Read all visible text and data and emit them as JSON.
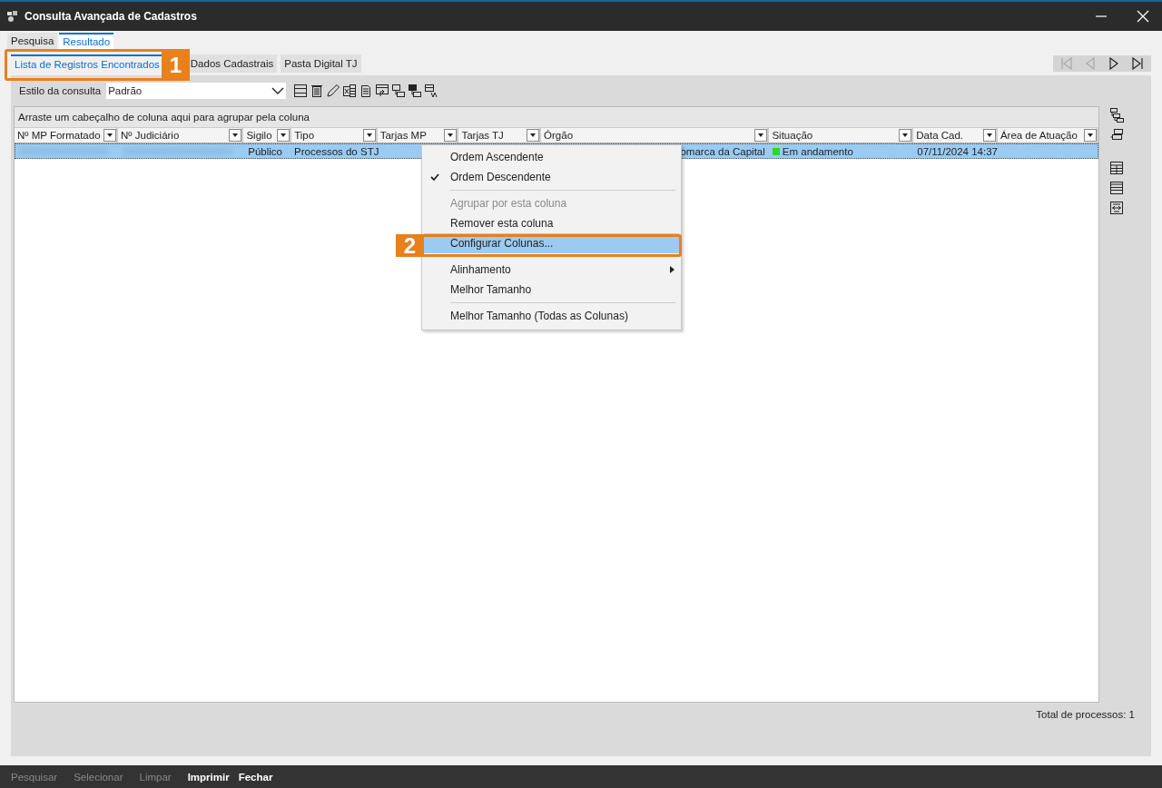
{
  "window": {
    "title": "Consulta Avançada de Cadastros"
  },
  "tabs": [
    {
      "label": "Pesquisa",
      "selected": false
    },
    {
      "label": "Resultado",
      "selected": true
    }
  ],
  "subtabs": [
    {
      "label": "Lista de Registros Encontrados",
      "selected": true
    },
    {
      "label": "Dados Cadastrais",
      "selected": false
    },
    {
      "label": "Pasta Digital TJ",
      "selected": false
    }
  ],
  "nav_buttons": [
    {
      "kind": "first",
      "disabled": true
    },
    {
      "kind": "prev",
      "disabled": true
    },
    {
      "kind": "next",
      "disabled": false
    },
    {
      "kind": "last",
      "disabled": false
    }
  ],
  "style_field": {
    "label": "Estilo da consulta",
    "value": "Padrão"
  },
  "group_hint": "Arraste um cabeçalho de coluna aqui para agrupar pela coluna",
  "columns": [
    {
      "label": "Nº MP Formatado"
    },
    {
      "label": "Nº Judiciário"
    },
    {
      "label": "Sigilo"
    },
    {
      "label": "Tipo"
    },
    {
      "label": "Tarjas MP"
    },
    {
      "label": "Tarjas TJ"
    },
    {
      "label": "Órgão"
    },
    {
      "label": "Situação"
    },
    {
      "label": "Data Cad."
    },
    {
      "label": "Área de Atuação"
    }
  ],
  "rows": [
    {
      "selected": true,
      "cells": [
        {
          "kind": "blurred"
        },
        {
          "kind": "blurred"
        },
        {
          "kind": "text",
          "text": "Público"
        },
        {
          "kind": "text",
          "text": "Processos do STJ"
        },
        {
          "kind": "empty"
        },
        {
          "kind": "empty"
        },
        {
          "kind": "clipped",
          "text": "omarca da Capital"
        },
        {
          "kind": "status",
          "color": "#22dd22",
          "text": "Em andamento"
        },
        {
          "kind": "text",
          "text": "07/11/2024 14:37"
        },
        {
          "kind": "empty"
        }
      ]
    }
  ],
  "context_menu": [
    {
      "kind": "item",
      "label": "Ordem Ascendente",
      "checked": false,
      "disabled": false,
      "selected": false,
      "submenu": false
    },
    {
      "kind": "item",
      "label": "Ordem Descendente",
      "checked": true,
      "disabled": false,
      "selected": false,
      "submenu": false
    },
    {
      "kind": "separator"
    },
    {
      "kind": "item",
      "label": "Agrupar por esta coluna",
      "checked": false,
      "disabled": true,
      "selected": false,
      "submenu": false
    },
    {
      "kind": "item",
      "label": "Remover esta coluna",
      "checked": false,
      "disabled": false,
      "selected": false,
      "submenu": false
    },
    {
      "kind": "item",
      "label": "Configurar Colunas...",
      "checked": false,
      "disabled": false,
      "selected": true,
      "submenu": false
    },
    {
      "kind": "separator"
    },
    {
      "kind": "item",
      "label": "Alinhamento",
      "checked": false,
      "disabled": false,
      "selected": false,
      "submenu": true
    },
    {
      "kind": "item",
      "label": "Melhor Tamanho",
      "checked": false,
      "disabled": false,
      "selected": false,
      "submenu": false
    },
    {
      "kind": "separator"
    },
    {
      "kind": "item",
      "label": "Melhor Tamanho (Todas as Colunas)",
      "checked": false,
      "disabled": false,
      "selected": false,
      "submenu": false
    }
  ],
  "callouts": [
    {
      "number": "1"
    },
    {
      "number": "2"
    }
  ],
  "total": "Total de processos: 1",
  "bottom_buttons": [
    {
      "label": "Pesquisar",
      "disabled": true
    },
    {
      "label": "Selecionar",
      "disabled": true
    },
    {
      "label": "Limpar",
      "disabled": true
    },
    {
      "label": "Imprimir",
      "disabled": false
    },
    {
      "label": "Fechar",
      "disabled": false
    }
  ]
}
